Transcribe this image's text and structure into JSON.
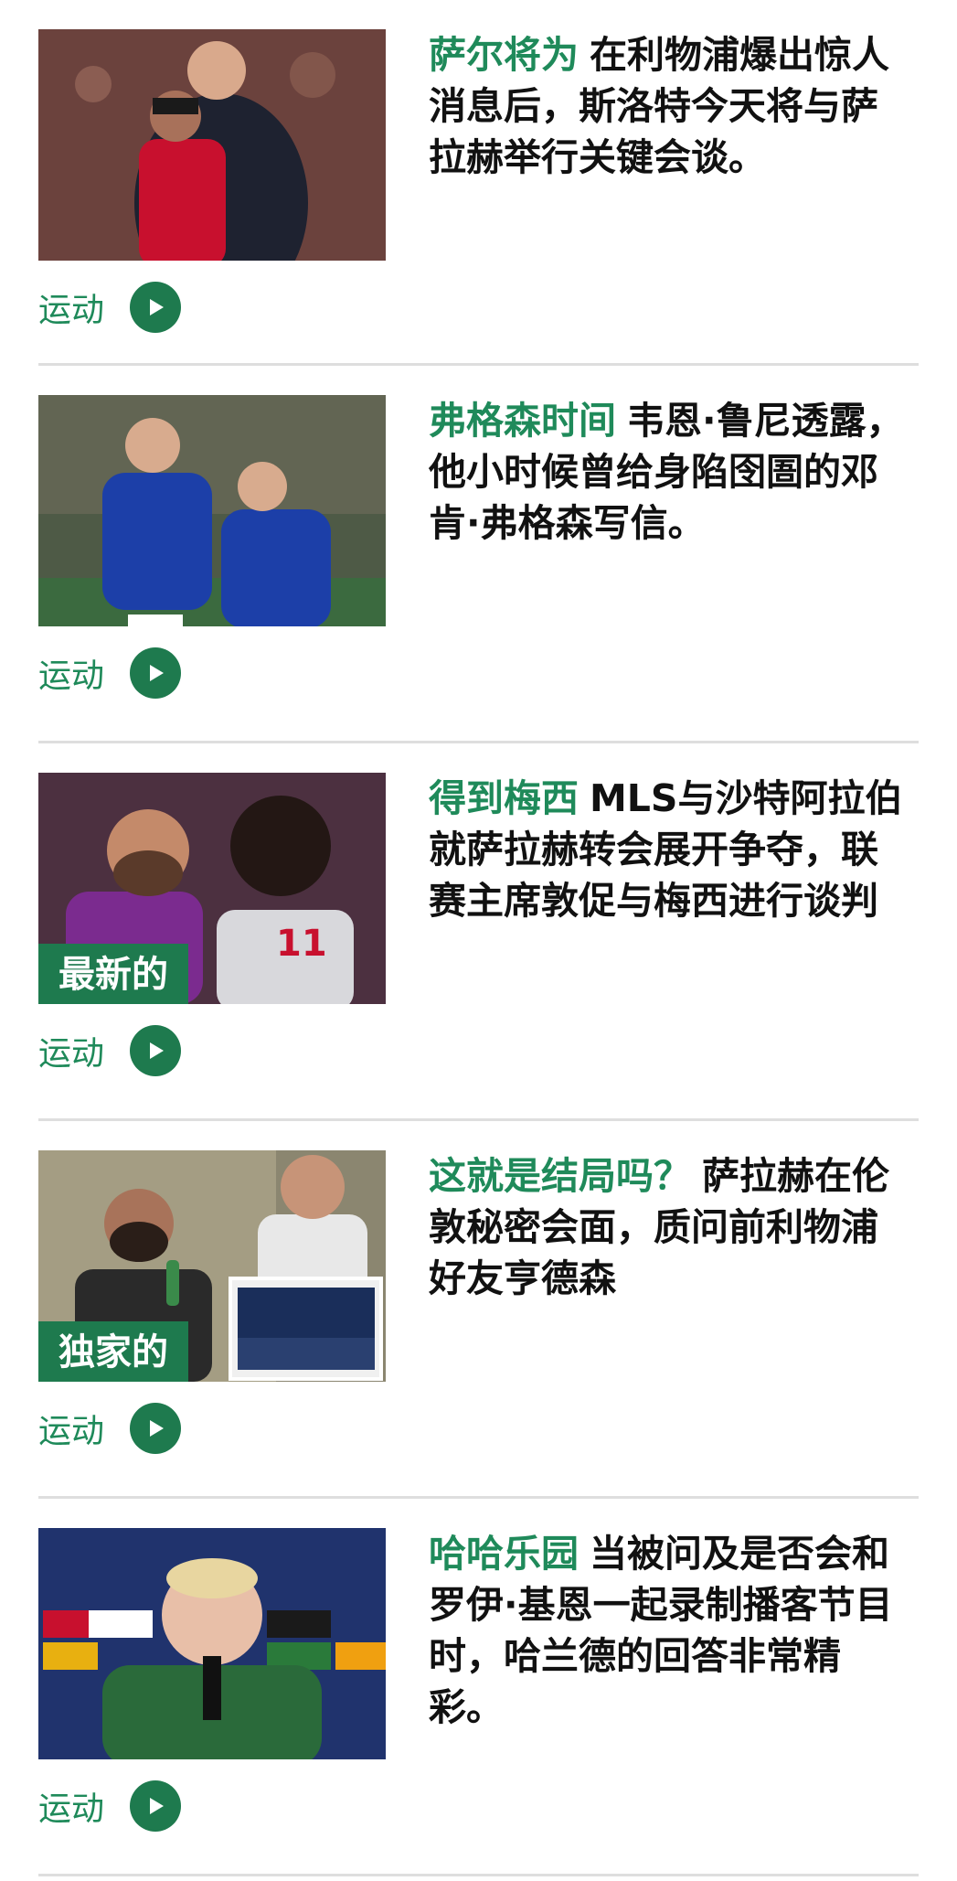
{
  "articles": [
    {
      "kicker": "萨尔将为",
      "headline": "在利物浦爆出惊人消息后，斯洛特今天将与萨拉赫举行关键会谈。",
      "category": "运动",
      "badge": ""
    },
    {
      "kicker": "弗格森时间",
      "headline": "韦恩·鲁尼透露，他小时候曾给身陷囹圄的邓肯·弗格森写信。",
      "category": "运动",
      "badge": ""
    },
    {
      "kicker": "得到梅西",
      "headline": "MLS与沙特阿拉伯就萨拉赫转会展开争夺，联赛主席敦促与梅西进行谈判",
      "category": "运动",
      "badge": "最新的"
    },
    {
      "kicker": "这就是结局吗？",
      "headline": "萨拉赫在伦敦秘密会面，质问前利物浦好友亨德森",
      "category": "运动",
      "badge": "独家的"
    },
    {
      "kicker": "哈哈乐园",
      "headline": "当被问及是否会和罗伊·基恩一起录制播客节目时，哈兰德的回答非常精彩。",
      "category": "运动",
      "badge": ""
    }
  ],
  "icons": {
    "play": "play-icon"
  },
  "colors": {
    "accent": "#1e7a4e",
    "kicker": "#1f8a5a",
    "divider": "#dedede"
  }
}
